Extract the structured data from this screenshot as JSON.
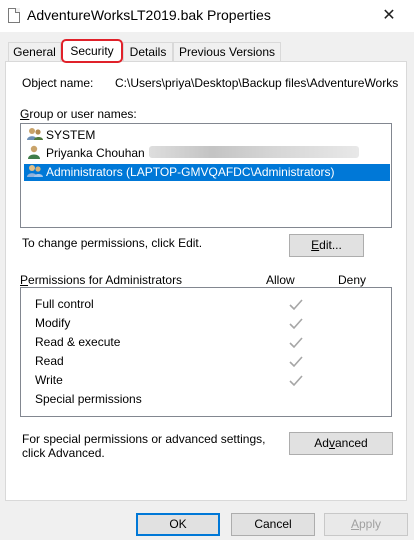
{
  "window": {
    "title": "AdventureWorksLT2019.bak Properties",
    "close_symbol": "✕"
  },
  "tabs": [
    {
      "label": "General"
    },
    {
      "label": "Security"
    },
    {
      "label": "Details"
    },
    {
      "label": "Previous Versions"
    }
  ],
  "object_name": {
    "label": "Object name:",
    "value": "C:\\Users\\priya\\Desktop\\Backup files\\AdventureWorks"
  },
  "groups": {
    "label_prefix": "G",
    "label_rest": "roup or user names:",
    "items": [
      {
        "name": "SYSTEM",
        "icon": "group-users-icon"
      },
      {
        "name": "Priyanka Chouhan",
        "icon": "user-icon",
        "redacted": true
      },
      {
        "name": "Administrators (LAPTOP-GMVQAFDC\\Administrators)",
        "icon": "group-users-icon",
        "selected": true
      }
    ]
  },
  "change_permissions_text": "To change permissions, click Edit.",
  "edit_button": {
    "prefix": "E",
    "rest": "dit..."
  },
  "permissions": {
    "header_prefix": "P",
    "header_rest": "ermissions for Administrators",
    "allow_label": "Allow",
    "deny_label": "Deny",
    "rows": [
      {
        "name": "Full control",
        "allow": true,
        "deny": false
      },
      {
        "name": "Modify",
        "allow": true,
        "deny": false
      },
      {
        "name": "Read & execute",
        "allow": true,
        "deny": false
      },
      {
        "name": "Read",
        "allow": true,
        "deny": false
      },
      {
        "name": "Write",
        "allow": true,
        "deny": false
      },
      {
        "name": "Special permissions",
        "allow": false,
        "deny": false
      }
    ]
  },
  "advanced_text_line1": "For special permissions or advanced settings,",
  "advanced_text_line2": "click Advanced.",
  "advanced_button": {
    "prefix": "Ad",
    "underlined": "v",
    "rest": "anced"
  },
  "footer": {
    "ok": "OK",
    "cancel": "Cancel",
    "apply": "Apply",
    "apply_underlined": "A",
    "apply_rest": "pply"
  },
  "colors": {
    "selection": "#0078d7",
    "highlight_ring": "#e0212a",
    "check_gray": "#a6a6a6"
  }
}
